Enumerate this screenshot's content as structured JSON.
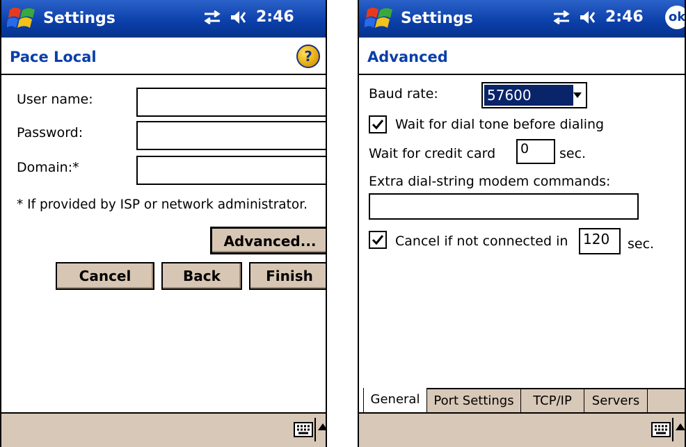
{
  "left": {
    "status_bar": {
      "app_title": "Settings",
      "time": "2:46"
    },
    "page_title": "Pace Local",
    "fields": {
      "user_name_label": "User name:",
      "password_label": "Password:",
      "domain_label": "Domain:*"
    },
    "note": "* If provided by ISP or network administrator.",
    "buttons": {
      "advanced": "Advanced...",
      "cancel": "Cancel",
      "back": "Back",
      "finish": "Finish"
    }
  },
  "right": {
    "status_bar": {
      "app_title": "Settings",
      "time": "2:46",
      "ok": "ok"
    },
    "page_title": "Advanced",
    "baud_rate": {
      "label": "Baud rate:",
      "value": "57600"
    },
    "wait_dial_tone": {
      "label": "Wait for dial tone before dialing",
      "checked": true
    },
    "credit_card": {
      "label": "Wait for credit card",
      "value": "0",
      "unit": "sec."
    },
    "extra_dial": {
      "label": "Extra dial-string modem commands:",
      "value": ""
    },
    "cancel_if": {
      "label": "Cancel if not connected in",
      "value": "120",
      "unit": "sec.",
      "checked": true
    },
    "tabs": [
      "General",
      "Port Settings",
      "TCP/IP",
      "Servers"
    ]
  },
  "colors": {
    "titlebar": "#0a3ea8",
    "button_face": "#d8c6b4",
    "selection": "#0a246a",
    "bottom_bar": "#d8c8b8"
  },
  "icons": [
    "windows-flag-icon",
    "connectivity-icon",
    "speaker-icon",
    "help-icon",
    "keyboard-icon",
    "up-arrow-icon"
  ]
}
